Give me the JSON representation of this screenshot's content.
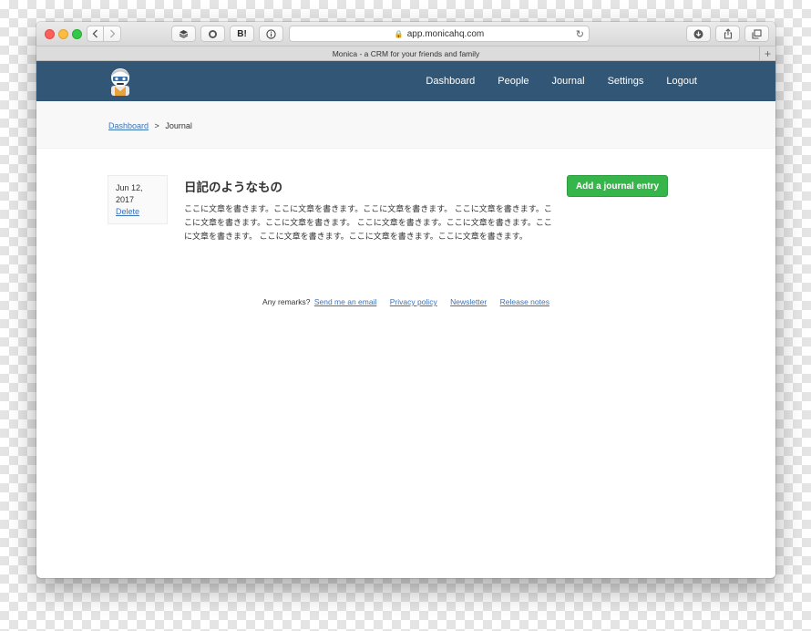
{
  "browser": {
    "url": "app.monicahq.com",
    "tab_title": "Monica - a CRM for your friends and family",
    "toolbar_buttons": [
      "layers-icon",
      "circle-icon",
      "B!",
      "info-icon"
    ]
  },
  "header": {
    "nav": [
      "Dashboard",
      "People",
      "Journal",
      "Settings",
      "Logout"
    ]
  },
  "breadcrumb": {
    "root": "Dashboard",
    "separator": ">",
    "current": "Journal"
  },
  "entry": {
    "date_line1": "Jun 12,",
    "date_line2": "2017",
    "delete_label": "Delete",
    "title": "日記のようなもの",
    "body": "ここに文章を書きます。ここに文章を書きます。ここに文章を書きます。 ここに文章を書きます。ここに文章を書きます。ここに文章を書きます。 ここに文章を書きます。ここに文章を書きます。ここに文章を書きます。 ここに文章を書きます。ここに文章を書きます。ここに文章を書きます。"
  },
  "actions": {
    "add_entry": "Add a journal entry"
  },
  "footer": {
    "remarks": "Any remarks?",
    "links": [
      "Send me an email",
      "Privacy policy",
      "Newsletter",
      "Release notes"
    ]
  },
  "colors": {
    "header_bg": "#325776",
    "link": "#3b73b9",
    "primary_button": "#36b54b"
  }
}
